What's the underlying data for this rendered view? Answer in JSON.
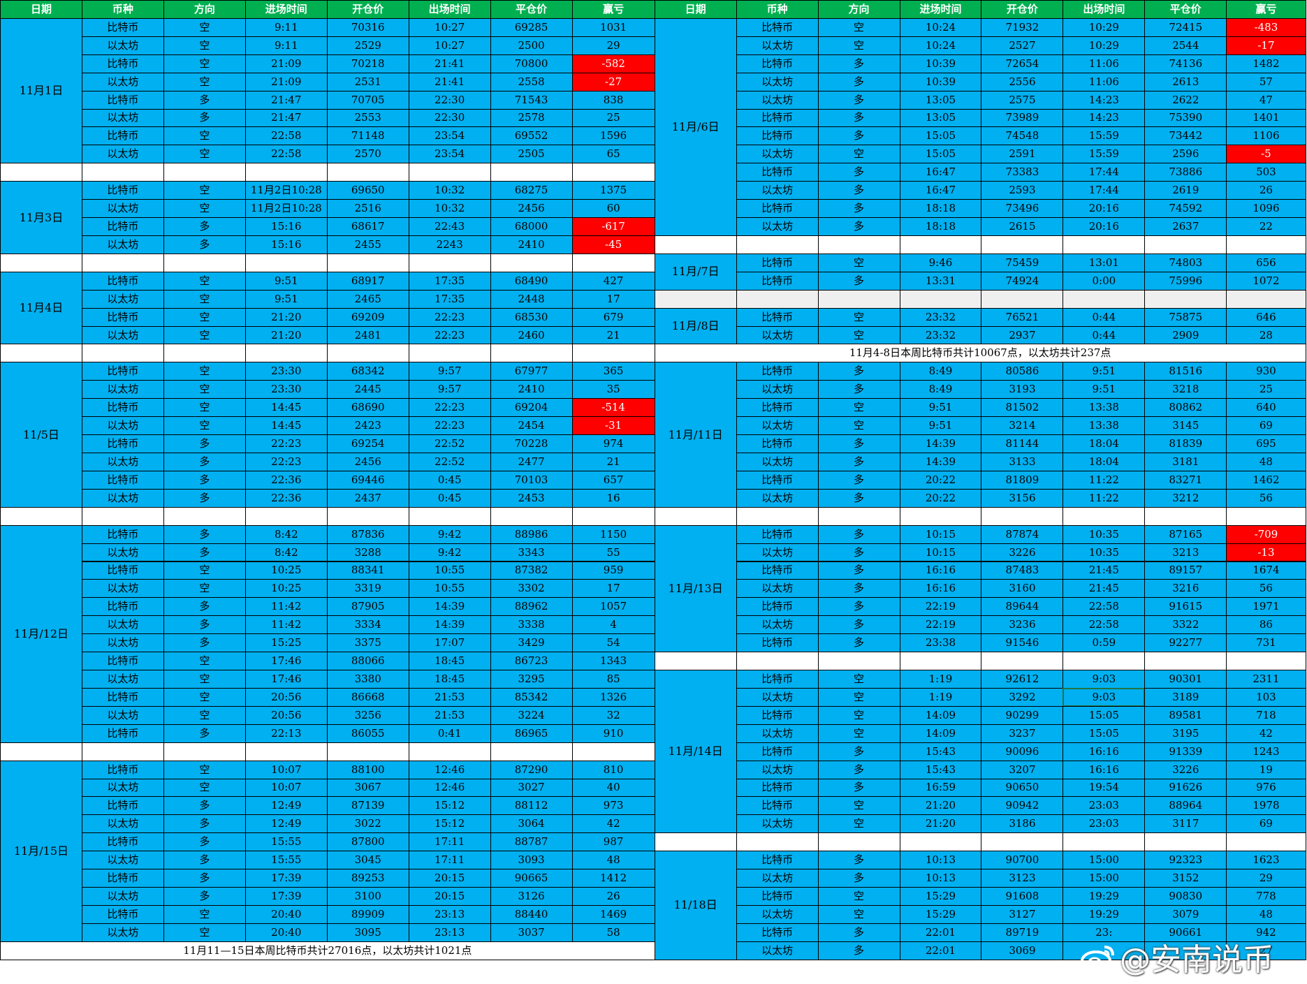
{
  "headers": [
    "日期",
    "币种",
    "方向",
    "进场时间",
    "开仓价",
    "出场时间",
    "平仓价",
    "赢亏"
  ],
  "colors": {
    "header_bg": "#00b050",
    "cell_bg": "#00b0f0",
    "loss_bg": "#ff0000",
    "grid": "#000000"
  },
  "left": [
    {
      "date": "11月1日",
      "rows": [
        [
          "比特币",
          "空",
          "9:11",
          "70316",
          "10:27",
          "69285",
          "1031"
        ],
        [
          "以太坊",
          "空",
          "9:11",
          "2529",
          "10:27",
          "2500",
          "29"
        ],
        [
          "比特币",
          "空",
          "21:09",
          "70218",
          "21:41",
          "70800",
          "-582"
        ],
        [
          "以太坊",
          "空",
          "21:09",
          "2531",
          "21:41",
          "2558",
          "-27"
        ],
        [
          "比特币",
          "多",
          "21:47",
          "70705",
          "22:30",
          "71543",
          "838"
        ],
        [
          "以太坊",
          "多",
          "21:47",
          "2553",
          "22:30",
          "2578",
          "25"
        ],
        [
          "比特币",
          "空",
          "22:58",
          "71148",
          "23:54",
          "69552",
          "1596"
        ],
        [
          "以太坊",
          "空",
          "22:58",
          "2570",
          "23:54",
          "2505",
          "65"
        ]
      ]
    },
    {
      "blank": true
    },
    {
      "date": "11月3日",
      "rows": [
        [
          "比特币",
          "空",
          "11月2日10:28",
          "69650",
          "10:32",
          "68275",
          "1375"
        ],
        [
          "以太坊",
          "空",
          "11月2日10:28",
          "2516",
          "10:32",
          "2456",
          "60"
        ],
        [
          "比特币",
          "多",
          "15:16",
          "68617",
          "22:43",
          "68000",
          "-617"
        ],
        [
          "以太坊",
          "多",
          "15:16",
          "2455",
          "2243",
          "2410",
          "-45"
        ]
      ]
    },
    {
      "blank": true
    },
    {
      "date": "11月4日",
      "rows": [
        [
          "比特币",
          "空",
          "9:51",
          "68917",
          "17:35",
          "68490",
          "427"
        ],
        [
          "以太坊",
          "空",
          "9:51",
          "2465",
          "17:35",
          "2448",
          "17"
        ],
        [
          "比特币",
          "空",
          "21:20",
          "69209",
          "22:23",
          "68530",
          "679"
        ],
        [
          "以太坊",
          "空",
          "21:20",
          "2481",
          "22:23",
          "2460",
          "21"
        ]
      ]
    },
    {
      "blank": true
    },
    {
      "date": "11/5日",
      "rows": [
        [
          "比特币",
          "空",
          "23:30",
          "68342",
          "9:57",
          "67977",
          "365"
        ],
        [
          "以太坊",
          "空",
          "23:30",
          "2445",
          "9:57",
          "2410",
          "35"
        ],
        [
          "比特币",
          "空",
          "14:45",
          "68690",
          "22:23",
          "69204",
          "-514"
        ],
        [
          "以太坊",
          "空",
          "14:45",
          "2423",
          "22:23",
          "2454",
          "-31"
        ],
        [
          "比特币",
          "多",
          "22:23",
          "69254",
          "22:52",
          "70228",
          "974"
        ],
        [
          "以太坊",
          "多",
          "22:23",
          "2456",
          "22:52",
          "2477",
          "21"
        ],
        [
          "比特币",
          "多",
          "22:36",
          "69446",
          "0:45",
          "70103",
          "657"
        ],
        [
          "以太坊",
          "多",
          "22:36",
          "2437",
          "0:45",
          "2453",
          "16"
        ]
      ]
    },
    {
      "blank": true
    },
    {
      "date": "11月/12日",
      "rows": [
        [
          "比特币",
          "多",
          "8:42",
          "87836",
          "9:42",
          "88986",
          "1150"
        ],
        [
          "以太坊",
          "多",
          "8:42",
          "3288",
          "9:42",
          "3343",
          "55"
        ],
        [
          "比特币",
          "空",
          "10:25",
          "88341",
          "10:55",
          "87382",
          "959"
        ],
        [
          "以太坊",
          "空",
          "10:25",
          "3319",
          "10:55",
          "3302",
          "17"
        ],
        [
          "比特币",
          "多",
          "11:42",
          "87905",
          "14:39",
          "88962",
          "1057"
        ],
        [
          "以太坊",
          "多",
          "11:42",
          "3334",
          "14:39",
          "3338",
          "4"
        ],
        [
          "以太坊",
          "多",
          "15:25",
          "3375",
          "17:07",
          "3429",
          "54"
        ],
        [
          "比特币",
          "空",
          "17:46",
          "88066",
          "18:45",
          "86723",
          "1343"
        ],
        [
          "以太坊",
          "空",
          "17:46",
          "3380",
          "18:45",
          "3295",
          "85"
        ],
        [
          "比特币",
          "空",
          "20:56",
          "86668",
          "21:53",
          "85342",
          "1326"
        ],
        [
          "以太坊",
          "空",
          "20:56",
          "3256",
          "21:53",
          "3224",
          "32"
        ],
        [
          "比特币",
          "多",
          "22:13",
          "86055",
          "0:41",
          "86965",
          "910"
        ]
      ]
    },
    {
      "blank": true
    },
    {
      "date": "11月/15日",
      "rows": [
        [
          "比特币",
          "空",
          "10:07",
          "88100",
          "12:46",
          "87290",
          "810"
        ],
        [
          "以太坊",
          "空",
          "10:07",
          "3067",
          "12:46",
          "3027",
          "40"
        ],
        [
          "比特币",
          "多",
          "12:49",
          "87139",
          "15:12",
          "88112",
          "973"
        ],
        [
          "以太坊",
          "多",
          "12:49",
          "3022",
          "15:12",
          "3064",
          "42"
        ],
        [
          "比特币",
          "多",
          "15:55",
          "87800",
          "17:11",
          "88787",
          "987"
        ],
        [
          "以太坊",
          "多",
          "15:55",
          "3045",
          "17:11",
          "3093",
          "48"
        ],
        [
          "比特币",
          "多",
          "17:39",
          "89253",
          "20:15",
          "90665",
          "1412"
        ],
        [
          "以太坊",
          "多",
          "17:39",
          "3100",
          "20:15",
          "3126",
          "26"
        ],
        [
          "比特币",
          "空",
          "20:40",
          "89909",
          "23:13",
          "88440",
          "1469"
        ],
        [
          "以太坊",
          "空",
          "20:40",
          "3095",
          "23:13",
          "3037",
          "58"
        ]
      ]
    },
    {
      "summary": "11月11—15日本周比特币共计27016点，以太坊共计1021点"
    }
  ],
  "right": [
    {
      "date": "11月/6日",
      "rows": [
        [
          "比特币",
          "空",
          "10:24",
          "71932",
          "10:29",
          "72415",
          "-483"
        ],
        [
          "以太坊",
          "空",
          "10:24",
          "2527",
          "10:29",
          "2544",
          "-17"
        ],
        [
          "比特币",
          "多",
          "10:39",
          "72654",
          "11:06",
          "74136",
          "1482"
        ],
        [
          "以太坊",
          "多",
          "10:39",
          "2556",
          "11:06",
          "2613",
          "57"
        ],
        [
          "以太坊",
          "多",
          "13:05",
          "2575",
          "14:23",
          "2622",
          "47"
        ],
        [
          "比特币",
          "多",
          "13:05",
          "73989",
          "14:23",
          "75390",
          "1401"
        ],
        [
          "比特币",
          "多",
          "15:05",
          "74548",
          "15:59",
          "73442",
          "1106"
        ],
        [
          "以太坊",
          "空",
          "15:05",
          "2591",
          "15:59",
          "2596",
          "-5"
        ],
        [
          "比特币",
          "多",
          "16:47",
          "73383",
          "17:44",
          "73886",
          "503"
        ],
        [
          "以太坊",
          "多",
          "16:47",
          "2593",
          "17:44",
          "2619",
          "26"
        ],
        [
          "比特币",
          "多",
          "18:18",
          "73496",
          "20:16",
          "74592",
          "1096"
        ],
        [
          "以太坊",
          "多",
          "18:18",
          "2615",
          "20:16",
          "2637",
          "22"
        ]
      ]
    },
    {
      "blank": true
    },
    {
      "date": "11月/7日",
      "rows": [
        [
          "比特币",
          "空",
          "9:46",
          "75459",
          "13:01",
          "74803",
          "656"
        ],
        [
          "比特币",
          "多",
          "13:31",
          "74924",
          "0:00",
          "75996",
          "1072"
        ]
      ]
    },
    {
      "blank": true,
      "grey": true
    },
    {
      "date": "11月/8日",
      "rows": [
        [
          "比特币",
          "空",
          "23:32",
          "76521",
          "0:44",
          "75875",
          "646"
        ],
        [
          "以太坊",
          "空",
          "23:32",
          "2937",
          "0:44",
          "2909",
          "28"
        ]
      ]
    },
    {
      "summary": "11月4-8日本周比特币共计10067点，以太坊共计237点"
    },
    {
      "date": "11月/11日",
      "rows": [
        [
          "比特币",
          "多",
          "8:49",
          "80586",
          "9:51",
          "81516",
          "930"
        ],
        [
          "以太坊",
          "多",
          "8:49",
          "3193",
          "9:51",
          "3218",
          "25"
        ],
        [
          "比特币",
          "空",
          "9:51",
          "81502",
          "13:38",
          "80862",
          "640"
        ],
        [
          "以太坊",
          "空",
          "9:51",
          "3214",
          "13:38",
          "3145",
          "69"
        ],
        [
          "比特币",
          "多",
          "14:39",
          "81144",
          "18:04",
          "81839",
          "695"
        ],
        [
          "以太坊",
          "多",
          "14:39",
          "3133",
          "18:04",
          "3181",
          "48"
        ],
        [
          "比特币",
          "多",
          "20:22",
          "81809",
          "11:22",
          "83271",
          "1462"
        ],
        [
          "以太坊",
          "多",
          "20:22",
          "3156",
          "11:22",
          "3212",
          "56"
        ]
      ]
    },
    {
      "blank": true
    },
    {
      "date": "11月/13日",
      "rows": [
        [
          "比特币",
          "多",
          "10:15",
          "87874",
          "10:35",
          "87165",
          "-709"
        ],
        [
          "以太坊",
          "多",
          "10:15",
          "3226",
          "10:35",
          "3213",
          "-13"
        ],
        [
          "比特币",
          "多",
          "16:16",
          "87483",
          "21:45",
          "89157",
          "1674"
        ],
        [
          "以太坊",
          "多",
          "16:16",
          "3160",
          "21:45",
          "3216",
          "56"
        ],
        [
          "比特币",
          "多",
          "22:19",
          "89644",
          "22:58",
          "91615",
          "1971"
        ],
        [
          "以太坊",
          "多",
          "22:19",
          "3236",
          "22:58",
          "3322",
          "86"
        ],
        [
          "比特币",
          "多",
          "23:38",
          "91546",
          "0:59",
          "92277",
          "731"
        ]
      ]
    },
    {
      "blank": true
    },
    {
      "date": "11月/14日",
      "rows": [
        [
          "比特币",
          "空",
          "1:19",
          "92612",
          "9:03",
          "90301",
          "2311"
        ],
        [
          "以太坊",
          "空",
          "1:19",
          "3292",
          "9:03",
          "3189",
          "103"
        ],
        [
          "比特币",
          "空",
          "14:09",
          "90299",
          "15:05",
          "89581",
          "718"
        ],
        [
          "以太坊",
          "空",
          "14:09",
          "3237",
          "15:05",
          "3195",
          "42"
        ],
        [
          "比特币",
          "多",
          "15:43",
          "90096",
          "16:16",
          "91339",
          "1243"
        ],
        [
          "以太坊",
          "多",
          "15:43",
          "3207",
          "16:16",
          "3226",
          "19"
        ],
        [
          "比特币",
          "多",
          "16:59",
          "90650",
          "19:54",
          "91626",
          "976"
        ],
        [
          "比特币",
          "空",
          "21:20",
          "90942",
          "23:03",
          "88964",
          "1978"
        ],
        [
          "以太坊",
          "空",
          "21:20",
          "3186",
          "23:03",
          "3117",
          "69"
        ]
      ]
    },
    {
      "blank": true
    },
    {
      "date": "11/18日",
      "rows": [
        [
          "比特币",
          "多",
          "10:13",
          "90700",
          "15:00",
          "92323",
          "1623"
        ],
        [
          "以太坊",
          "多",
          "10:13",
          "3123",
          "15:00",
          "3152",
          "29"
        ],
        [
          "比特币",
          "空",
          "15:29",
          "91608",
          "19:29",
          "90830",
          "778"
        ],
        [
          "以太坊",
          "空",
          "15:29",
          "3127",
          "19:29",
          "3079",
          "48"
        ],
        [
          "比特币",
          "多",
          "22:01",
          "89719",
          "23:",
          "90661",
          "942"
        ],
        [
          "以太坊",
          "多",
          "22:01",
          "3069",
          "",
          "",
          "27"
        ]
      ]
    }
  ],
  "watermark": {
    "text": "@安南说币",
    "icon": "weibo-icon"
  }
}
